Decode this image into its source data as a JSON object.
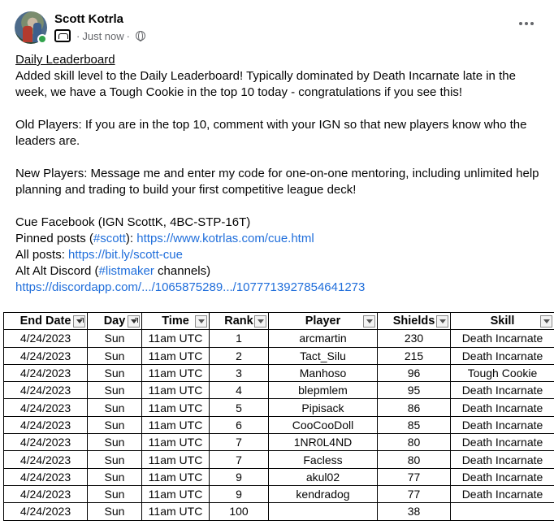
{
  "post": {
    "author": "Scott Kotrla",
    "timestamp": "Just now",
    "separator": "·",
    "title": "Daily Leaderboard",
    "para1": "Added skill level to the Daily Leaderboard! Typically dominated by Death Incarnate late in the week, we have a Tough Cookie in the top 10 today - congratulations if you see this!",
    "para2": "Old Players: If you are in the top 10, comment with your IGN so that new players know who the leaders are.",
    "para3": "New Players: Message me and enter my code for one-on-one mentoring, including unlimited help planning and trading to build your first competitive league deck!",
    "cue_line": "Cue Facebook (IGN ScottK, 4BC-STP-16T)",
    "pinned_prefix": "Pinned posts (",
    "pinned_hashtag": "#scott",
    "pinned_mid": "): ",
    "pinned_link": "https://www.kotrlas.com/cue.html",
    "all_prefix": "All posts: ",
    "all_link": "https://bit.ly/scott-cue",
    "discord_prefix": "Alt Alt Discord (",
    "discord_hashtag": "#listmaker",
    "discord_suffix": " channels)",
    "discord_link": "https://discordapp.com/.../1065875289.../1077713927854641273"
  },
  "table": {
    "headers": [
      "End Date",
      "Day",
      "Time",
      "Rank",
      "Player",
      "Shields",
      "Skill"
    ],
    "rows": [
      [
        "4/24/2023",
        "Sun",
        "11am UTC",
        "1",
        "arcmartin",
        "230",
        "Death Incarnate"
      ],
      [
        "4/24/2023",
        "Sun",
        "11am UTC",
        "2",
        "Tact_Silu",
        "215",
        "Death Incarnate"
      ],
      [
        "4/24/2023",
        "Sun",
        "11am UTC",
        "3",
        "Manhoso",
        "96",
        "Tough Cookie"
      ],
      [
        "4/24/2023",
        "Sun",
        "11am UTC",
        "4",
        "blepmlem",
        "95",
        "Death Incarnate"
      ],
      [
        "4/24/2023",
        "Sun",
        "11am UTC",
        "5",
        "Pipisack",
        "86",
        "Death Incarnate"
      ],
      [
        "4/24/2023",
        "Sun",
        "11am UTC",
        "6",
        "CooCooDoll",
        "85",
        "Death Incarnate"
      ],
      [
        "4/24/2023",
        "Sun",
        "11am UTC",
        "7",
        "1NR0L4ND",
        "80",
        "Death Incarnate"
      ],
      [
        "4/24/2023",
        "Sun",
        "11am UTC",
        "7",
        "Facless",
        "80",
        "Death Incarnate"
      ],
      [
        "4/24/2023",
        "Sun",
        "11am UTC",
        "9",
        "akul02",
        "77",
        "Death Incarnate"
      ],
      [
        "4/24/2023",
        "Sun",
        "11am UTC",
        "9",
        "kendradog",
        "77",
        "Death Incarnate"
      ],
      [
        "4/24/2023",
        "Sun",
        "11am UTC",
        "100",
        "",
        "38",
        ""
      ]
    ]
  },
  "colors": {
    "link": "#216fdb",
    "online": "#31a24c",
    "meta": "#65676b"
  }
}
